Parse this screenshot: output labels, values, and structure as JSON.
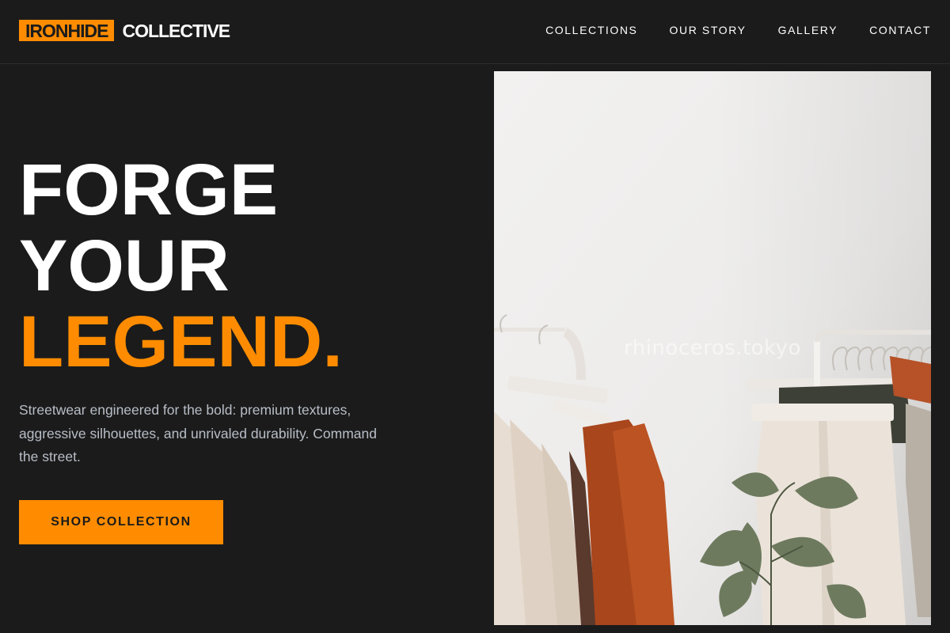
{
  "brand": {
    "accent_word": "IRONHIDE",
    "main_word": "COLLECTIVE"
  },
  "nav": {
    "items": [
      {
        "label": "COLLECTIONS"
      },
      {
        "label": "OUR STORY"
      },
      {
        "label": "GALLERY"
      },
      {
        "label": "CONTACT"
      }
    ]
  },
  "hero": {
    "line1": "FORGE",
    "line2": "YOUR",
    "line3": "LEGEND.",
    "description": "Streetwear engineered for the bold: premium textures, aggressive silhouettes, and unrivaled durability. Command the street.",
    "cta_label": "SHOP COLLECTION"
  },
  "photo": {
    "watermark": "rhinoceros.tokyo",
    "subject": "clothing rack with garments and plant"
  },
  "colors": {
    "background": "#1b1b1b",
    "accent": "#ff8c00",
    "text": "#ffffff",
    "muted_text": "#b8bec7"
  }
}
